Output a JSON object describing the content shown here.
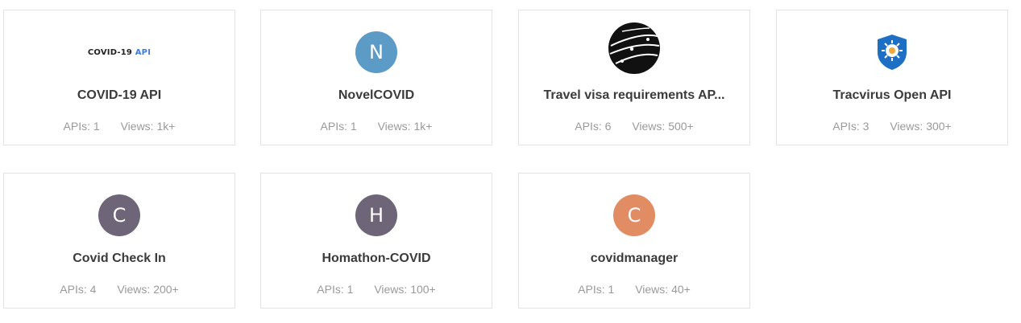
{
  "cards": [
    {
      "title": "COVID-19 API",
      "logo_text": "COVID-19",
      "logo_accent": "API",
      "apis_label": "APIs:",
      "apis": "1",
      "views_label": "Views:",
      "views": "1k+",
      "icon": "covid-19-api-logo"
    },
    {
      "title": "NovelCOVID",
      "avatar_letter": "N",
      "avatar_color": "#5b9bc6",
      "apis_label": "APIs:",
      "apis": "1",
      "views_label": "Views:",
      "views": "1k+"
    },
    {
      "title": "Travel visa requirements AP...",
      "apis_label": "APIs:",
      "apis": "6",
      "views_label": "Views:",
      "views": "500+",
      "icon": "globe-icon"
    },
    {
      "title": "Tracvirus Open API",
      "apis_label": "APIs:",
      "apis": "3",
      "views_label": "Views:",
      "views": "300+",
      "icon": "shield-virus-icon"
    },
    {
      "title": "Covid Check In",
      "avatar_letter": "C",
      "avatar_color": "#6e6578",
      "apis_label": "APIs:",
      "apis": "4",
      "views_label": "Views:",
      "views": "200+"
    },
    {
      "title": "Homathon-COVID",
      "avatar_letter": "H",
      "avatar_color": "#6e6578",
      "apis_label": "APIs:",
      "apis": "1",
      "views_label": "Views:",
      "views": "100+"
    },
    {
      "title": "covidmanager",
      "avatar_letter": "C",
      "avatar_color": "#e28c64",
      "apis_label": "APIs:",
      "apis": "1",
      "views_label": "Views:",
      "views": "40+"
    }
  ]
}
